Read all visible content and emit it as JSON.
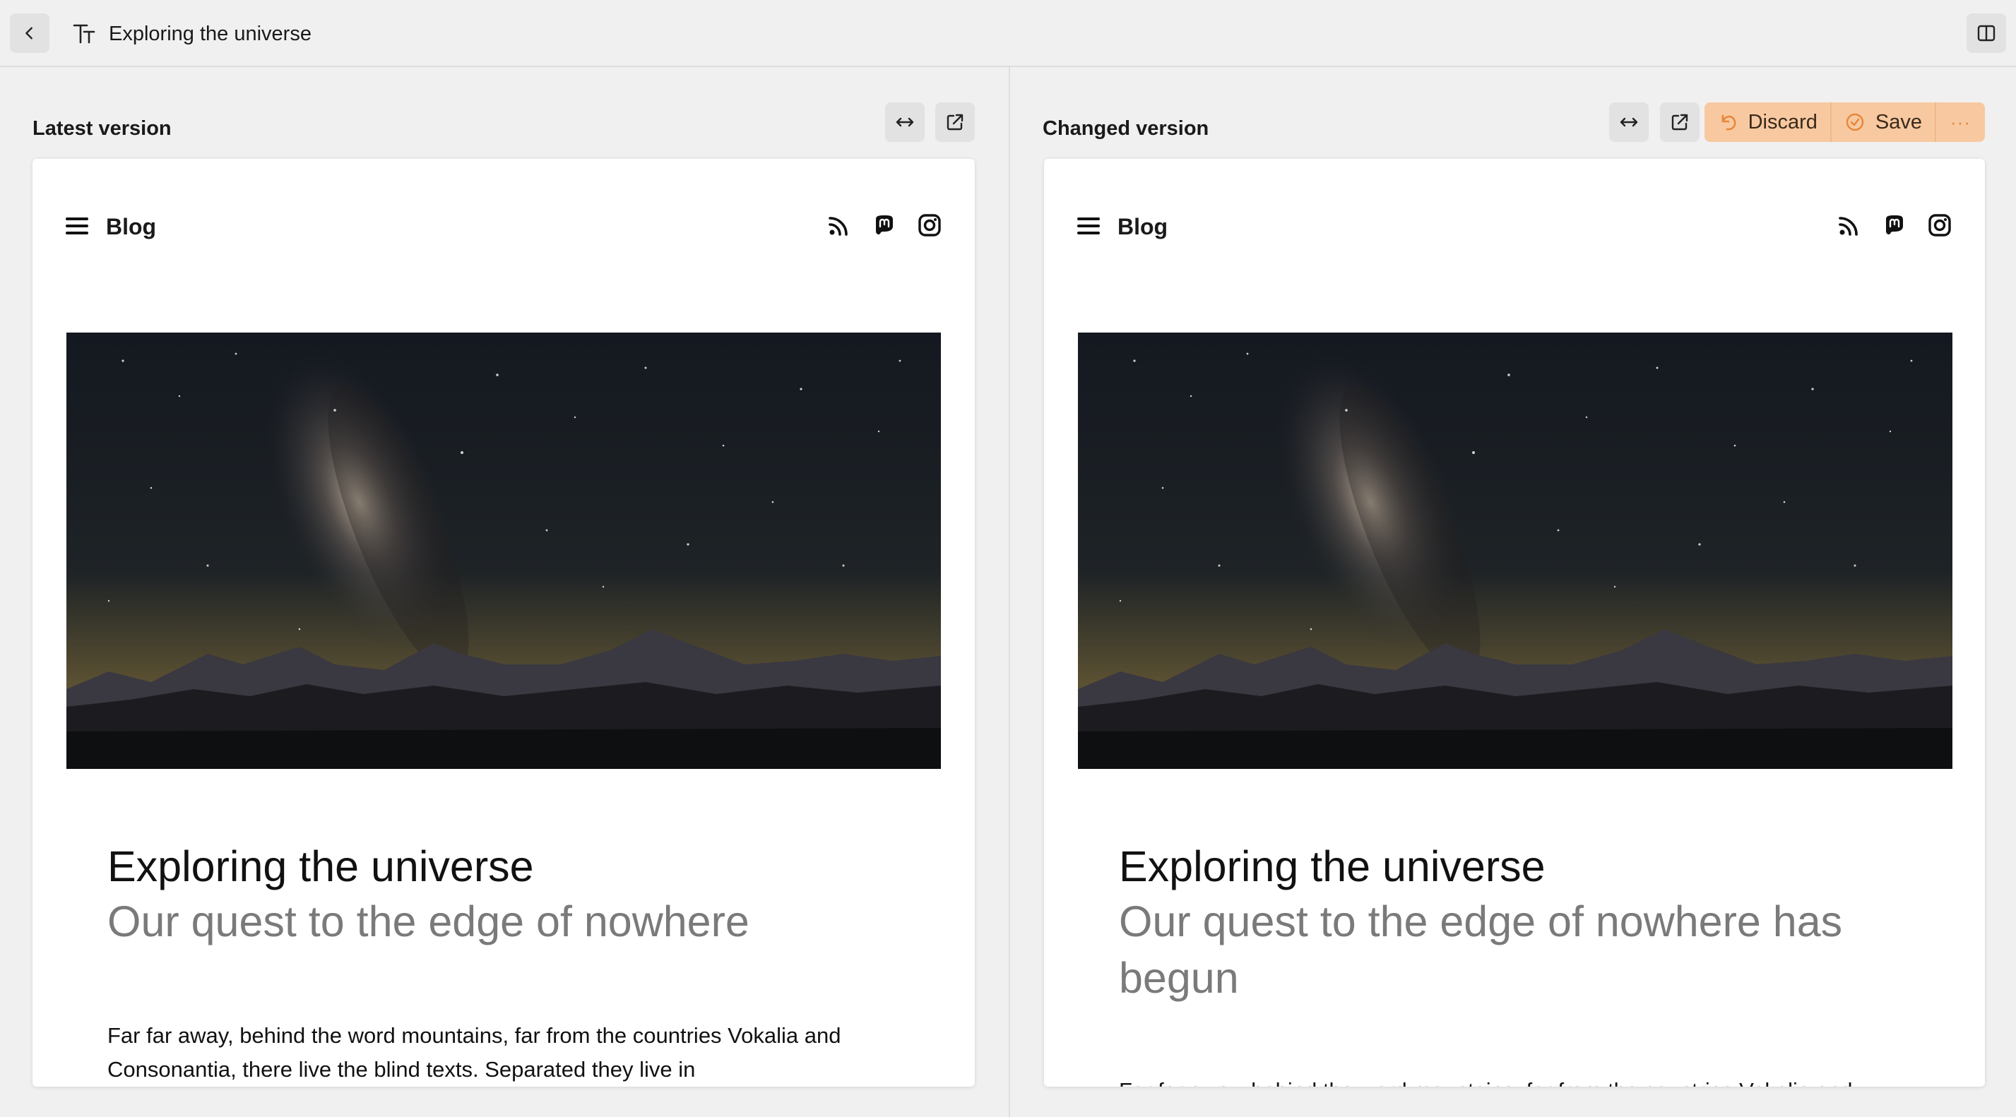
{
  "header": {
    "back_icon": "chevron-left-icon",
    "type_icon": "text-size-icon",
    "title": "Exploring the universe",
    "split_icon": "split-view-icon"
  },
  "panes": {
    "left": {
      "heading": "Latest version",
      "blog": {
        "brand": "Blog",
        "title": "Exploring the universe",
        "subtitle": "Our quest to the edge of nowhere",
        "body": "Far far away, behind the word mountains, far from the countries Vokalia and Consonantia, there live the blind texts. Separated they live in"
      }
    },
    "right": {
      "heading": "Changed version",
      "discard_label": "Discard",
      "save_label": "Save",
      "more_label": "···",
      "blog": {
        "brand": "Blog",
        "title": "Exploring the universe",
        "subtitle": "Our quest to the edge of nowhere has begun",
        "body": "Far far away, behind the word mountains, far from the countries Vokalia and Consonantia, there live the blind texts."
      }
    }
  },
  "colors": {
    "accent": "#f8c9a1",
    "accent_icon": "#e8863a",
    "subtitle": "#7a7a7a"
  }
}
